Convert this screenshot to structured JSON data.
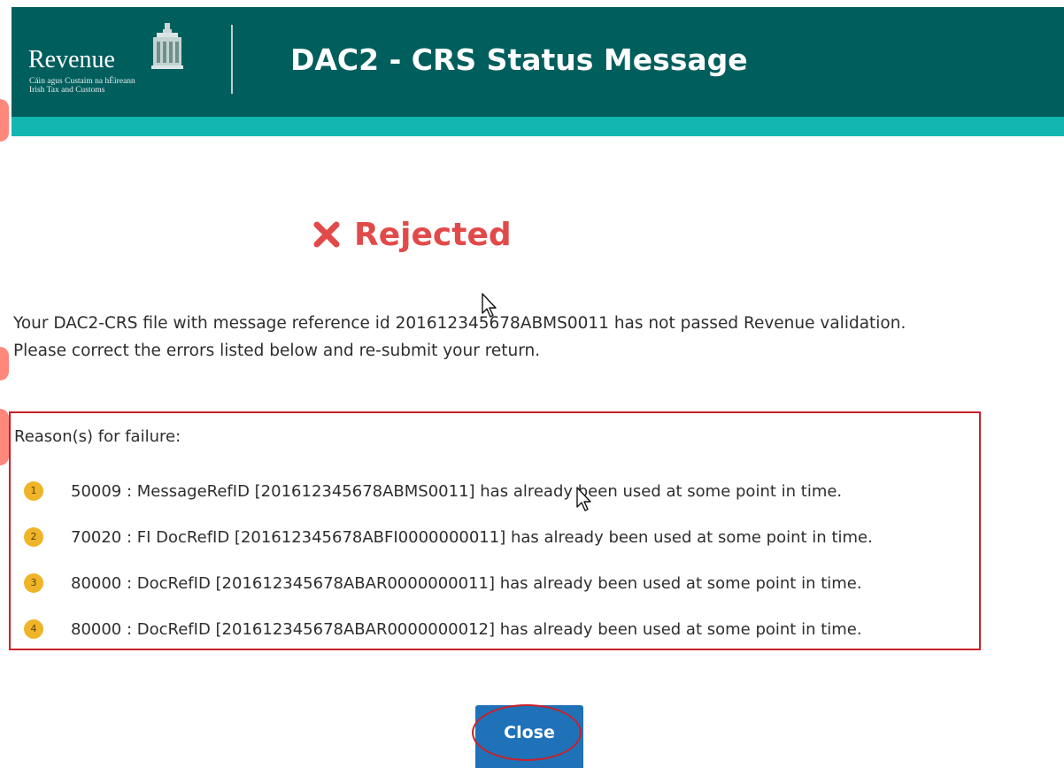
{
  "header": {
    "logo": {
      "wordmark": "Revenue",
      "subtitle_line1": "Cáin agus Custaim na hÉireann",
      "subtitle_line2": "Irish Tax and Customs"
    },
    "title": "DAC2 - CRS Status Message"
  },
  "status": {
    "label": "Rejected",
    "icon": "x-icon",
    "color": "#e24a4a"
  },
  "message": {
    "line1": "Your DAC2-CRS file with message reference id 201612345678ABMS0011 has not passed Revenue validation.",
    "line2": "Please correct the errors listed below and re-submit your return."
  },
  "reasons": {
    "title": "Reason(s) for failure:",
    "items": [
      {
        "number": "1",
        "text": "50009 : MessageRefID [201612345678ABMS0011] has already been used at some point in time."
      },
      {
        "number": "2",
        "text": "70020 : FI DocRefID [201612345678ABFI0000000011] has already been used at some point in time."
      },
      {
        "number": "3",
        "text": "80000 : DocRefID [201612345678ABAR0000000011] has already been used at some point in time."
      },
      {
        "number": "4",
        "text": "80000 : DocRefID [201612345678ABAR0000000012] has already been used at some point in time."
      }
    ]
  },
  "close_button": {
    "label": "Close"
  },
  "colors": {
    "header_bg": "#005e5d",
    "header_stripe": "#13b5b1",
    "highlight_border": "#c8212b",
    "badge": "#f0b429",
    "button": "#1f72b8"
  }
}
